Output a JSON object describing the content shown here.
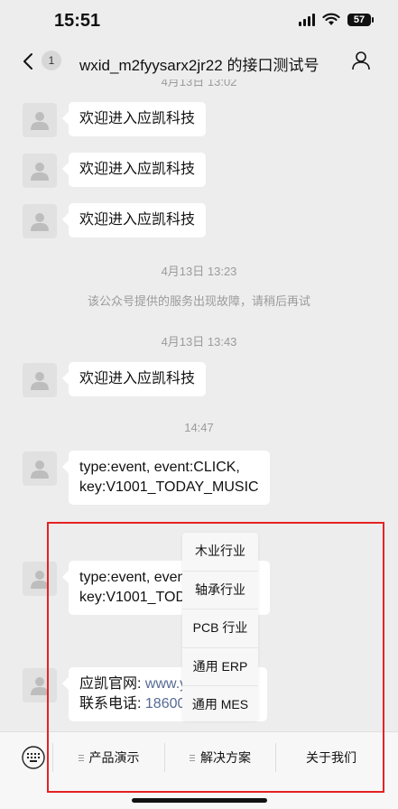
{
  "status_bar": {
    "time": "15:51",
    "battery": "57"
  },
  "nav": {
    "unread_count": "1",
    "title": "wxid_m2fyysarx2jr22 的接口测试号"
  },
  "messages": {
    "ts_partial": "4月13日 13:02",
    "m1": "欢迎进入应凯科技",
    "m2": "欢迎进入应凯科技",
    "m3": "欢迎进入应凯科技",
    "ts2": "4月13日 13:23",
    "system_notice": "该公众号提供的服务出现故障，请稍后再试",
    "ts3": "4月13日 13:43",
    "m4": "欢迎进入应凯科技",
    "ts4": "14:47",
    "m5_line1": "type:event, event:CLICK,",
    "m5_line2": "key:V1001_TODAY_MUSIC",
    "m6_line1": "type:event, event:CLICK,",
    "m6_line2": "key:V1001_TODAY_MUSIC",
    "m7_label1": "应凯官网: ",
    "m7_link1": "www.yingkai.com",
    "m7_label2": "联系电话: ",
    "m7_link2": "18600000000"
  },
  "submenu": {
    "items": [
      "木业行业",
      "轴承行业",
      "PCB 行业",
      "通用 ERP",
      "通用 MES"
    ]
  },
  "menu": {
    "items": [
      "产品演示",
      "解决方案",
      "关于我们"
    ]
  },
  "colors": {
    "highlight": "#e52222",
    "link": "#576b95"
  }
}
